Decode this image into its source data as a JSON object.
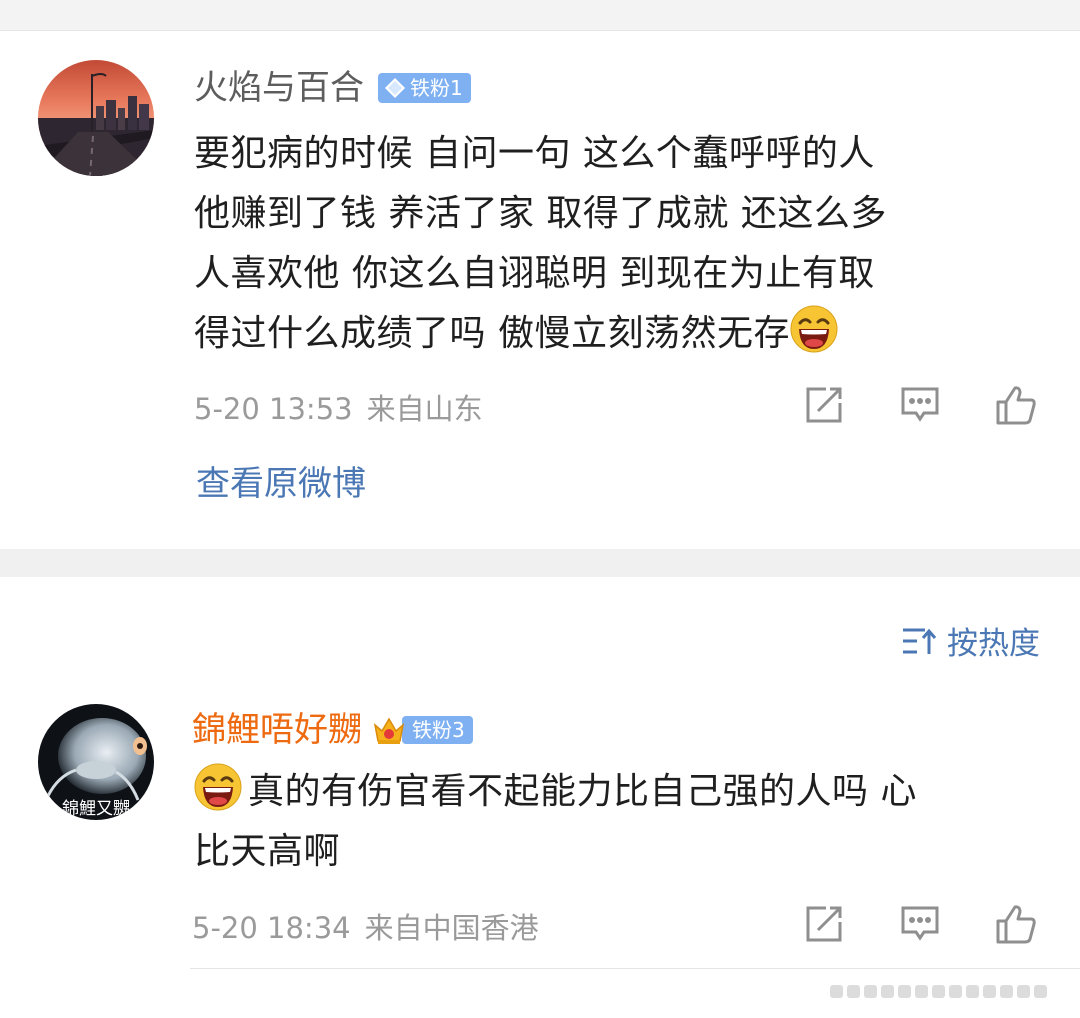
{
  "comments": [
    {
      "username": "火焰与百合",
      "badge": "铁粉1",
      "lines": [
        "要犯病的时候 自问一句 这么个蠢呼呼的人",
        "他赚到了钱 养活了家 取得了成就 还这么多",
        "人喜欢他  你这么自诩聪明 到现在为止有取",
        "得过什么成绩了吗 傲慢立刻荡然无存"
      ],
      "emoji": "laughing-emoji",
      "date": "5-20 13:53",
      "location": "来自山东",
      "link": "查看原微博"
    },
    {
      "username": "錦鯉唔好嬲",
      "badge": "铁粉3",
      "avatar_text": "錦鯉又嬲",
      "lines": [
        "真的有伤官看不起能力比自己强的人吗 心",
        "比天高啊"
      ],
      "emoji": "laughing-emoji",
      "date": "5-20 18:34",
      "location": "来自中国香港"
    }
  ],
  "sort": {
    "label": "按热度"
  },
  "icons": {
    "share": "share-icon",
    "comment": "comment-icon",
    "like": "like-icon"
  },
  "colors": {
    "link": "#4b78b4",
    "orange_name": "#ee6a10",
    "badge": "#7fb1f2",
    "meta": "#9a9a9a"
  }
}
